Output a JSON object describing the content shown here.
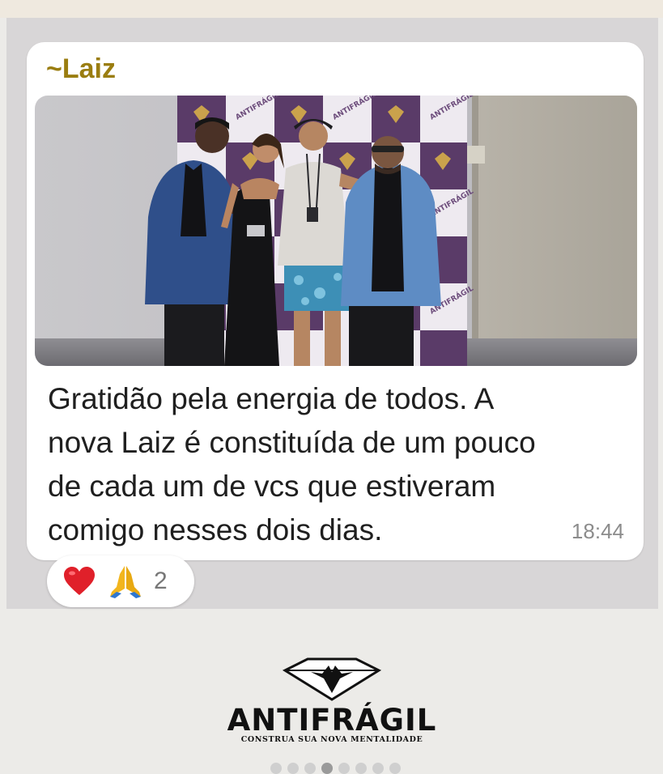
{
  "message": {
    "sender": "~Laiz",
    "caption_lines": [
      "Gratidão pela energia de todos. A",
      "nova Laiz é constituída de um pouco",
      "de cada um de vcs que estiveram",
      "comigo nesses dois dias."
    ],
    "time": "18:44",
    "photo": {
      "banner_text": "ANTIFRÁGIL",
      "people": 4
    }
  },
  "reactions": {
    "icons": [
      "heart-icon",
      "praying-hands-icon"
    ],
    "count": "2"
  },
  "brand": {
    "wordmark": "ANTIFRÁGIL",
    "tagline": "CONSTRUA SUA NOVA MENTALIDADE"
  },
  "pager": {
    "total": 8,
    "active": 3
  },
  "colors": {
    "sender": "#9a7d10",
    "chat_background": "#d8d6d7",
    "backdrop_purple": "#5a3b68"
  }
}
